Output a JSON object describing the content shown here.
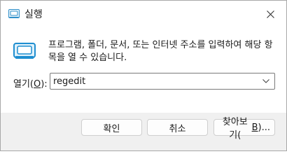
{
  "window": {
    "title": "실행",
    "close_icon": "close-icon"
  },
  "dialog": {
    "description": "프로그램, 폴더, 문서, 또는 인터넷 주소를 입력하여 해당 항목을 열 수 있습니다.",
    "run_icon": "run-icon"
  },
  "open_field": {
    "label_prefix": "열기(",
    "label_accesskey": "O",
    "label_suffix": "):",
    "value": "regedit",
    "dropdown_icon": "chevron-down-icon"
  },
  "buttons": {
    "ok_label": "확인",
    "cancel_label": "취소",
    "browse_prefix": "찾아보기(",
    "browse_accesskey": "B",
    "browse_suffix": ")..."
  }
}
